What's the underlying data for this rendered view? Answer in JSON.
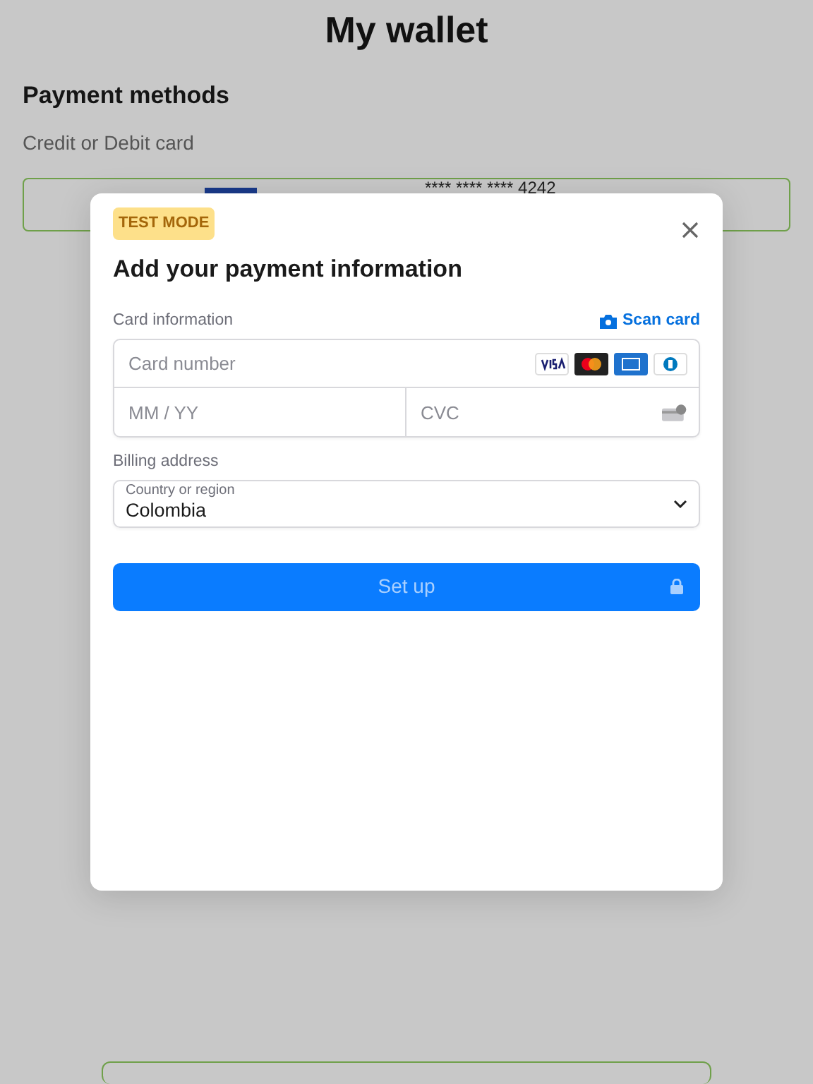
{
  "page": {
    "title": "My wallet",
    "section_title": "Payment methods",
    "section_subtitle": "Credit or Debit card"
  },
  "saved_card": {
    "number": "**** **** **** 4242"
  },
  "modal": {
    "badge": "TEST MODE",
    "title": "Add your payment information",
    "card_label": "Card information",
    "scan_link": "Scan card",
    "card_number": {
      "placeholder": "Card number"
    },
    "expiry": {
      "placeholder": "MM / YY"
    },
    "cvc": {
      "placeholder": "CVC"
    },
    "billing_label": "Billing address",
    "country": {
      "label": "Country or region",
      "value": "Colombia"
    },
    "submit": {
      "label": "Set up",
      "disabled": true
    }
  }
}
